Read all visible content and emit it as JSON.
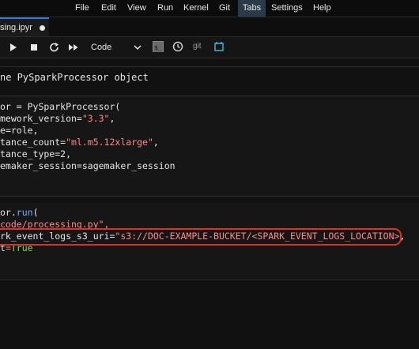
{
  "menu": {
    "items": [
      "File",
      "Edit",
      "View",
      "Run",
      "Kernel",
      "Git",
      "Tabs",
      "Settings",
      "Help"
    ],
    "active": "Tabs"
  },
  "tab": {
    "label": "sing.ipyr"
  },
  "toolbar": {
    "cell_type": "Code",
    "git_label": "git"
  },
  "cells": {
    "markdown": "ne PySparkProcessor object",
    "cell1": {
      "l1a": "or = PySparkProcessor(",
      "l2a": "mework_version=",
      "l2b": "\"3.3\"",
      "l2c": ",",
      "l3a": "e=role,",
      "l4a": "tance_count=",
      "l4b": "\"ml.m5.12xlarge\"",
      "l4c": ",",
      "l5a": "tance_type=2,",
      "l6a": "emaker_session=sagemaker_session"
    },
    "cell2": {
      "l1a": "or.",
      "l1b": "run",
      "l1c": "(",
      "l2a": "code/processing.py",
      "l2b": "\",",
      "l3a": "rk_event_logs_s3_uri=",
      "l3b": "\"s3://DOC-EXAMPLE-BUCKET/<SPARK_EVENT_LOGS_LOCATION>",
      "l3c": ",",
      "l4a": "t",
      "l4b": "=",
      "l4c": "True"
    }
  },
  "colors": {
    "accent": "#2c7be5",
    "string": "#ff8a8a",
    "function": "#6fa8ff",
    "keyword": "#7ed957",
    "highlight": "#e0301e"
  }
}
